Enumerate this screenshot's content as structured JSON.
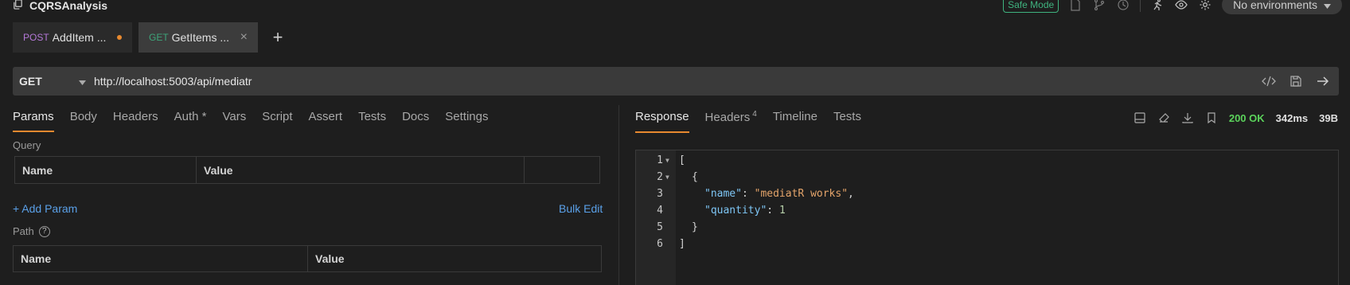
{
  "app": {
    "title": "CQRSAnalysis"
  },
  "titlebar": {
    "safe_mode": "Safe Mode",
    "environment": "No environments"
  },
  "tabs": [
    {
      "method": "POST",
      "name": "AddItem ..."
    },
    {
      "method": "GET",
      "name": "GetItems ..."
    }
  ],
  "request": {
    "method": "GET",
    "url": "http://localhost:5003/api/mediatr"
  },
  "left_tabs": [
    "Params",
    "Body",
    "Headers",
    "Auth *",
    "Vars",
    "Script",
    "Assert",
    "Tests",
    "Docs",
    "Settings"
  ],
  "params": {
    "query_label": "Query",
    "name_col": "Name",
    "value_col": "Value",
    "add_param": "+ Add Param",
    "bulk_edit": "Bulk Edit",
    "path_label": "Path"
  },
  "right_tabs": {
    "response": "Response",
    "headers": "Headers",
    "headers_count": "4",
    "timeline": "Timeline",
    "tests": "Tests"
  },
  "response": {
    "status": "200 OK",
    "time": "342ms",
    "size": "39B",
    "lines": [
      {
        "n": "1",
        "text": "["
      },
      {
        "n": "2",
        "text": "{"
      },
      {
        "n": "3",
        "key": "\"name\"",
        "value": "\"mediatR works\""
      },
      {
        "n": "4",
        "key": "\"quantity\"",
        "value": "1"
      },
      {
        "n": "5",
        "text": "}"
      },
      {
        "n": "6",
        "text": "]"
      }
    ]
  },
  "colors": {
    "accent": "#e8892f",
    "post": "#b478d8",
    "get": "#3ea57a",
    "link": "#5aa0e8",
    "ok": "#5bd35b"
  }
}
